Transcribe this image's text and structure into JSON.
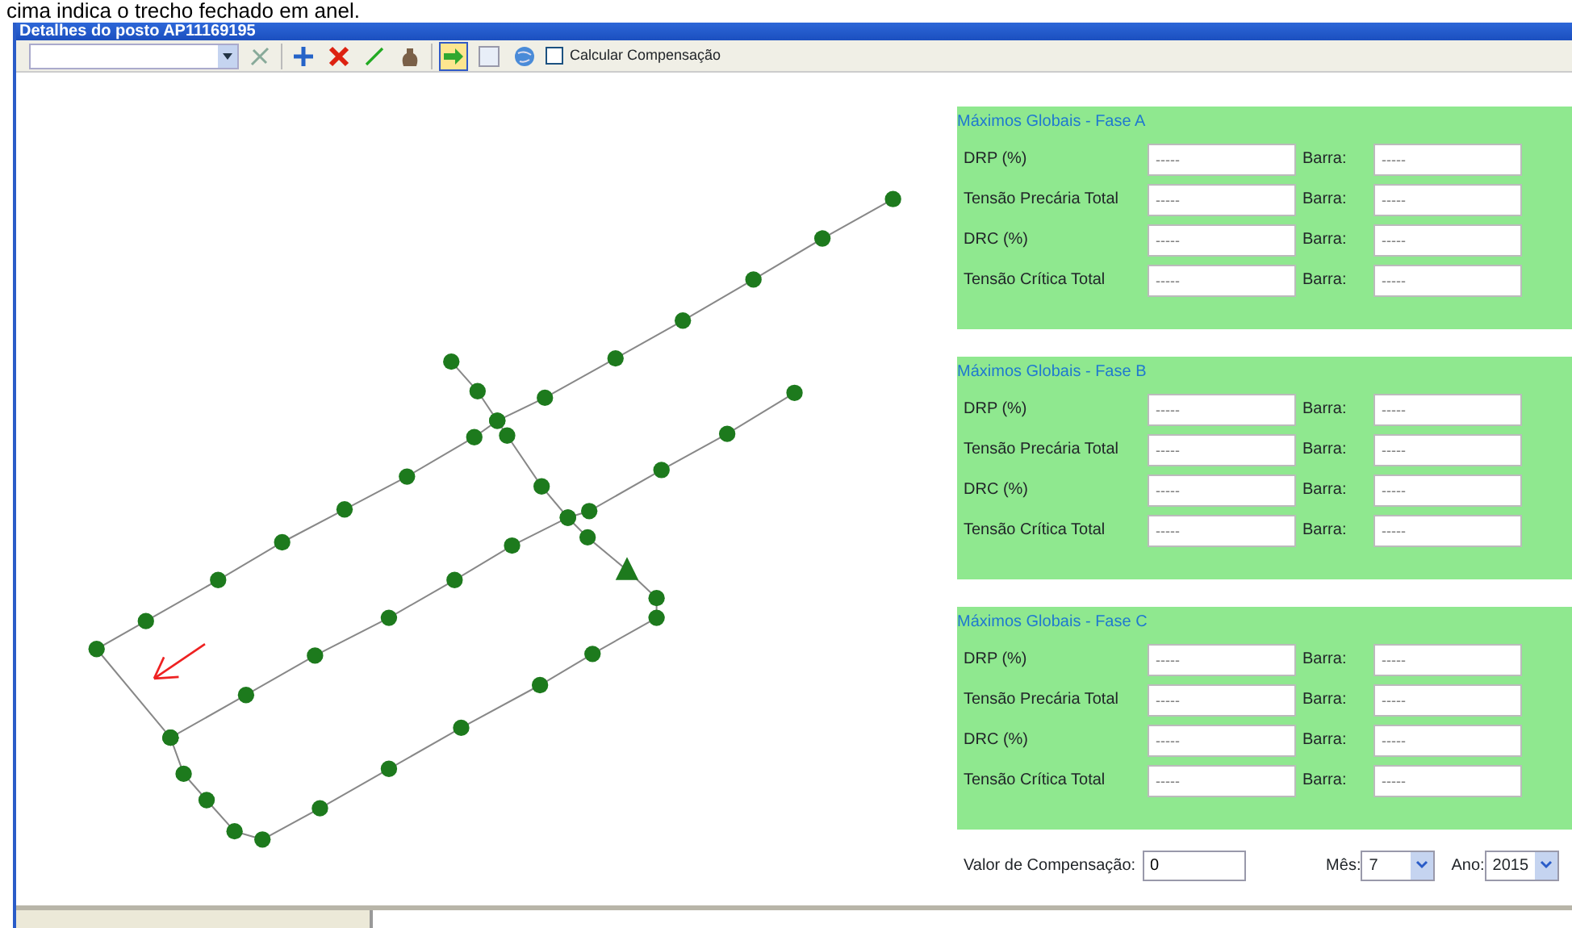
{
  "caption": "cima indica o trecho fechado em anel.",
  "window": {
    "title": "Detalhes do posto AP11169195"
  },
  "toolbar": {
    "tools": [
      {
        "kind": "select",
        "selected": false
      },
      {
        "kind": "add",
        "selected": false
      },
      {
        "kind": "delete",
        "selected": false
      },
      {
        "kind": "line",
        "selected": false
      },
      {
        "kind": "bag",
        "selected": false
      },
      {
        "kind": "arrow",
        "selected": true
      },
      {
        "kind": "blank",
        "selected": false
      },
      {
        "kind": "globe",
        "selected": false
      }
    ],
    "checkbox": {
      "label": "Calcular Compensação",
      "checked": false
    }
  },
  "panels": [
    {
      "title": "Máximos Globais - Fase A",
      "rows": [
        {
          "label": "DRP (%)",
          "value": "-----",
          "barra_label": "Barra:",
          "barra_value": "-----"
        },
        {
          "label": "Tensão Precária Total",
          "value": "-----",
          "barra_label": "Barra:",
          "barra_value": "-----"
        },
        {
          "label": "DRC (%)",
          "value": "-----",
          "barra_label": "Barra:",
          "barra_value": "-----"
        },
        {
          "label": "Tensão Crítica Total",
          "value": "-----",
          "barra_label": "Barra:",
          "barra_value": "-----"
        }
      ]
    },
    {
      "title": "Máximos Globais - Fase B",
      "rows": [
        {
          "label": "DRP (%)",
          "value": "-----",
          "barra_label": "Barra:",
          "barra_value": "-----"
        },
        {
          "label": "Tensão Precária Total",
          "value": "-----",
          "barra_label": "Barra:",
          "barra_value": "-----"
        },
        {
          "label": "DRC (%)",
          "value": "-----",
          "barra_label": "Barra:",
          "barra_value": "-----"
        },
        {
          "label": "Tensão Crítica Total",
          "value": "-----",
          "barra_label": "Barra:",
          "barra_value": "-----"
        }
      ]
    },
    {
      "title": "Máximos Globais - Fase C",
      "rows": [
        {
          "label": "DRP (%)",
          "value": "-----",
          "barra_label": "Barra:",
          "barra_value": "-----"
        },
        {
          "label": "Tensão Precária Total",
          "value": "-----",
          "barra_label": "Barra:",
          "barra_value": "-----"
        },
        {
          "label": "DRC (%)",
          "value": "-----",
          "barra_label": "Barra:",
          "barra_value": "-----"
        },
        {
          "label": "Tensão Crítica Total",
          "value": "-----",
          "barra_label": "Barra:",
          "barra_value": "-----"
        }
      ]
    }
  ],
  "footer": {
    "compensation_label": "Valor de Compensação:",
    "compensation_value": "0",
    "month_label": "Mês:",
    "month_value": "7",
    "year_label": "Ano:",
    "year_value": "2015"
  }
}
